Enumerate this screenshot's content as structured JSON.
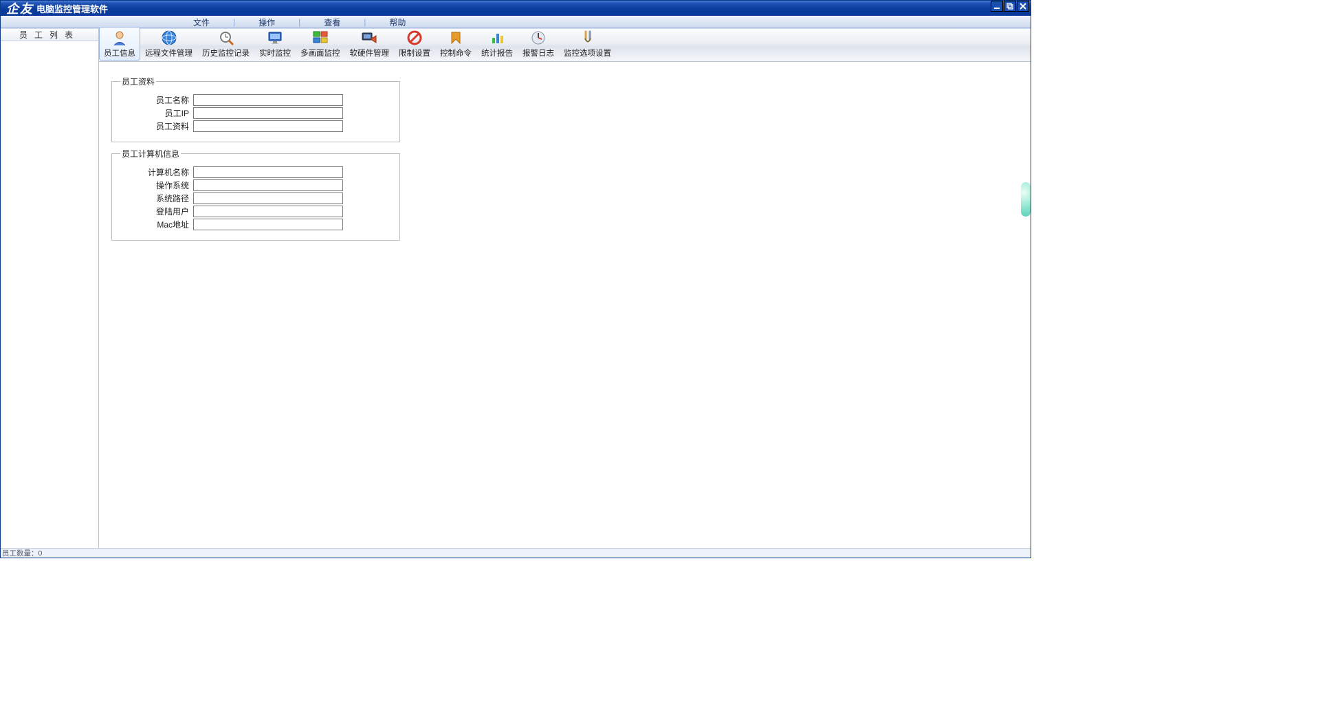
{
  "titlebar": {
    "logo": "企友",
    "subtitle": "电脑监控管理软件"
  },
  "menubar": {
    "items": [
      "文件",
      "操作",
      "查看",
      "帮助"
    ]
  },
  "sidebar": {
    "header": "员工列表"
  },
  "toolbar": {
    "items": [
      {
        "label": "员工信息",
        "icon": "user-icon",
        "active": true
      },
      {
        "label": "远程文件管理",
        "icon": "globe-icon",
        "active": false
      },
      {
        "label": "历史监控记录",
        "icon": "history-icon",
        "active": false
      },
      {
        "label": "实时监控",
        "icon": "monitor-icon",
        "active": false
      },
      {
        "label": "多画面监控",
        "icon": "multiview-icon",
        "active": false
      },
      {
        "label": "软硬件管理",
        "icon": "hardware-icon",
        "active": false
      },
      {
        "label": "限制设置",
        "icon": "forbid-icon",
        "active": false
      },
      {
        "label": "控制命令",
        "icon": "command-icon",
        "active": false
      },
      {
        "label": "统计报告",
        "icon": "report-icon",
        "active": false
      },
      {
        "label": "报警日志",
        "icon": "alarm-icon",
        "active": false
      },
      {
        "label": "监控选项设置",
        "icon": "settings-icon",
        "active": false
      }
    ]
  },
  "groups": {
    "employee": {
      "legend": "员工资料",
      "fields": {
        "name": {
          "label": "员工名称",
          "value": ""
        },
        "ip": {
          "label": "员工IP",
          "value": ""
        },
        "info": {
          "label": "员工资料",
          "value": ""
        }
      }
    },
    "computer": {
      "legend": "员工计算机信息",
      "fields": {
        "hostname": {
          "label": "计算机名称",
          "value": ""
        },
        "os": {
          "label": "操作系统",
          "value": ""
        },
        "syspath": {
          "label": "系统路径",
          "value": ""
        },
        "loginuser": {
          "label": "登陆用户",
          "value": ""
        },
        "mac": {
          "label": "Mac地址",
          "value": ""
        }
      }
    }
  },
  "statusbar": {
    "text": "员工数量：0"
  }
}
